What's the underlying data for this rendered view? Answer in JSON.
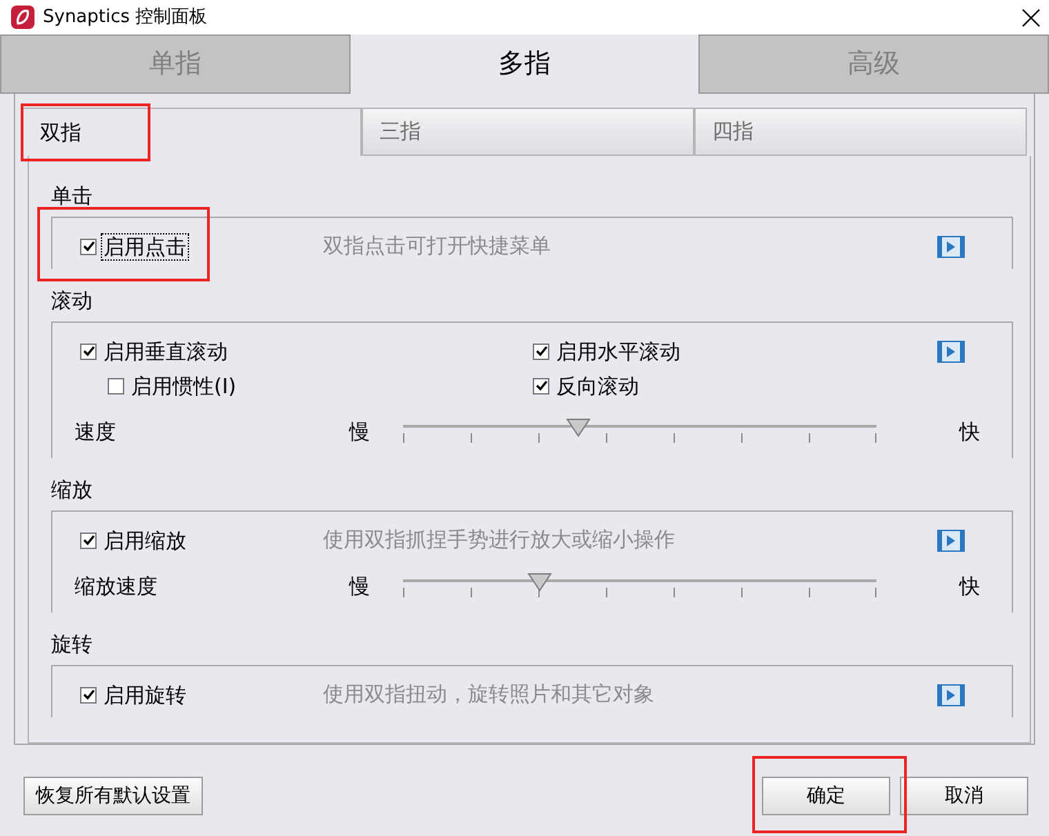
{
  "window": {
    "title": "Synaptics 控制面板"
  },
  "tabs": [
    {
      "label": "单指",
      "selected": false
    },
    {
      "label": "多指",
      "selected": true
    },
    {
      "label": "高级",
      "selected": false
    }
  ],
  "subtabs": [
    {
      "label": "双指",
      "selected": true
    },
    {
      "label": "三指",
      "selected": false
    },
    {
      "label": "四指",
      "selected": false
    }
  ],
  "sections": [
    {
      "title": "单击",
      "checks": [
        {
          "label": "启用点击",
          "checked": true,
          "indented": false,
          "focused": true
        }
      ],
      "description": "双指点击可打开快捷菜单"
    },
    {
      "title": "滚动",
      "checks": [
        {
          "label": "启用垂直滚动",
          "checked": true,
          "indented": false,
          "focused": false
        },
        {
          "label": "启用水平滚动",
          "checked": true,
          "indented": false,
          "focused": false
        },
        {
          "label": "启用惯性(I)",
          "checked": false,
          "indented": true,
          "focused": false
        },
        {
          "label": "反向滚动",
          "checked": true,
          "indented": false,
          "focused": false
        }
      ],
      "slider": {
        "label": "速度",
        "low": "慢",
        "high": "快",
        "level": 0.37
      }
    },
    {
      "title": "缩放",
      "checks": [
        {
          "label": "启用缩放",
          "checked": true,
          "indented": false,
          "focused": false
        }
      ],
      "description": "使用双指抓捏手势进行放大或缩小操作",
      "slider": {
        "label": "缩放速度",
        "low": "慢",
        "high": "快",
        "level": 0.29
      }
    },
    {
      "title": "旋转",
      "checks": [
        {
          "label": "启用旋转",
          "checked": true,
          "indented": false,
          "focused": false
        }
      ],
      "description": "使用双指扭动，旋转照片和其它对象"
    }
  ],
  "buttons": [
    {
      "label": "恢复所有默认设置"
    },
    {
      "label": "确定"
    },
    {
      "label": "取消"
    }
  ]
}
